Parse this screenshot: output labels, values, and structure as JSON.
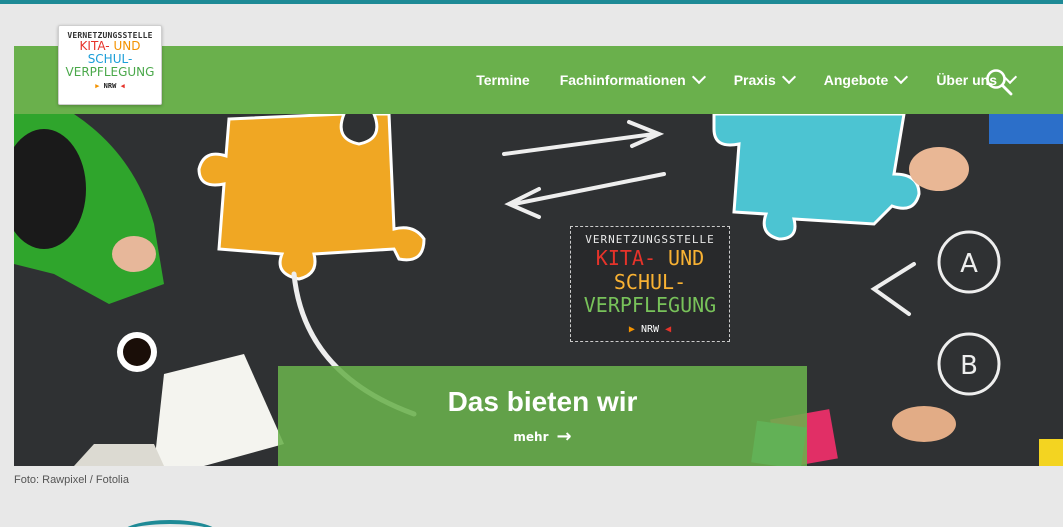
{
  "colors": {
    "primary_green": "#6ab04c",
    "top_stripe": "#1e8a96",
    "hero_bg": "#2f3133"
  },
  "logo": {
    "line1": "VERNETZUNGSSTELLE",
    "line2_kita": "KITA-",
    "line2_und": " UND ",
    "line2_schul": "SCHUL-",
    "line3": "VERPFLEGUNG",
    "line4": "NRW"
  },
  "nav": {
    "items": [
      {
        "label": "Termine",
        "has_dropdown": false
      },
      {
        "label": "Fachinformationen",
        "has_dropdown": true
      },
      {
        "label": "Praxis",
        "has_dropdown": true
      },
      {
        "label": "Angebote",
        "has_dropdown": true
      },
      {
        "label": "Über uns",
        "has_dropdown": true
      }
    ],
    "search_icon": "search-icon"
  },
  "hero": {
    "chalk_logo": {
      "line1": "VERNETZUNGSSTELLE",
      "line2_kita": "KITA-",
      "line2_rest": " UND SCHUL-",
      "line3": "VERPFLEGUNG",
      "line4": "NRW"
    },
    "circle_a": "A",
    "circle_b": "B",
    "cta": {
      "title": "Das bieten wir",
      "more": "mehr",
      "more_icon": "arrow-right-icon"
    }
  },
  "credit": "Foto: Rawpixel / Fotolia"
}
